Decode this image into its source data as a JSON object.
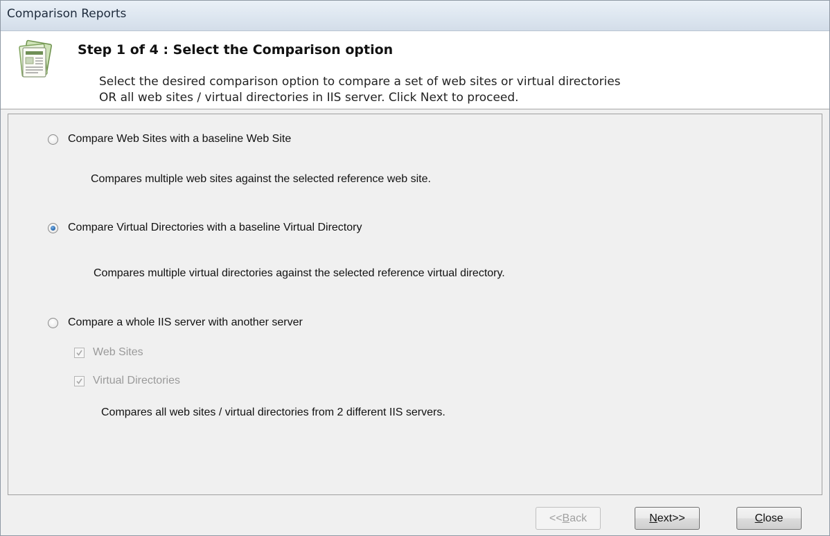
{
  "window": {
    "title": "Comparison Reports"
  },
  "header": {
    "icon": "report-document-icon",
    "step_title": "Step 1 of 4 : Select the Comparison option",
    "description_line1": "Select the desired comparison option to compare a set of web sites or virtual directories",
    "description_line2": "OR all web sites / virtual directories in IIS server. Click Next to proceed."
  },
  "options": [
    {
      "label": "Compare Web Sites with a baseline Web Site",
      "description": "Compares multiple web sites against the selected reference web site.",
      "selected": false
    },
    {
      "label": "Compare Virtual Directories with a baseline Virtual Directory",
      "description": "Compares multiple virtual directories against the selected reference virtual directory.",
      "selected": true
    },
    {
      "label": "Compare a whole IIS server with another server",
      "description": "Compares all web sites / virtual directories from 2 different IIS servers.",
      "selected": false,
      "sub_options": [
        {
          "label": "Web Sites",
          "checked": true,
          "enabled": false
        },
        {
          "label": "Virtual Directories",
          "checked": true,
          "enabled": false
        }
      ]
    }
  ],
  "buttons": {
    "back": {
      "prefix": "<<",
      "key": "B",
      "rest": "ack",
      "enabled": false
    },
    "next": {
      "prefix": "",
      "key": "N",
      "rest": "ext>>",
      "enabled": true
    },
    "close": {
      "prefix": "",
      "key": "C",
      "rest": "lose",
      "enabled": true
    }
  },
  "colors": {
    "titlebar": "#dde6f0",
    "background": "#f0f0f0",
    "radio_selected": "#2b6db3",
    "disabled_text": "#9a9a9a"
  }
}
